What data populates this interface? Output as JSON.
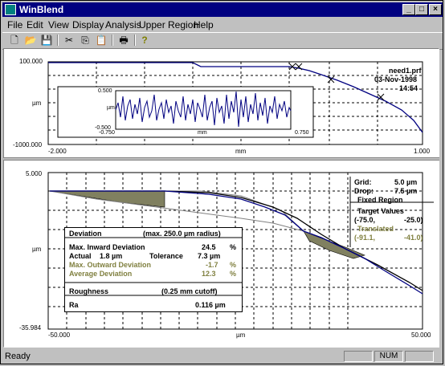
{
  "window": {
    "title": "WinBlend",
    "min": "_",
    "max": "□",
    "close": "×"
  },
  "menu": [
    "File",
    "Edit",
    "View",
    "Display",
    "Analysis",
    "Upper Region",
    "Help"
  ],
  "top_plot": {
    "file": "need1.prf",
    "date": "03-Nov-1998",
    "time": "14:54",
    "y_top": "100.000",
    "y_unit": "µm",
    "y_bottom": "-1000.000",
    "x_left": "-2.000",
    "x_unit": "mm",
    "x_right": "1.000",
    "inset": {
      "y_top": "0.500",
      "y_unit": "µm",
      "y_bottom": "-0.500",
      "x_left": "-0.750",
      "x_unit": "mm",
      "x_right": "0.750"
    }
  },
  "bottom_plot": {
    "y_top": "5.000",
    "y_unit": "µm",
    "y_bottom": "-35.984",
    "x_left": "-50.000",
    "x_unit": "µm",
    "x_right": "50.000"
  },
  "info": {
    "grid_label": "Grid:",
    "grid_value": "5.0  µm",
    "drop_label": "Drop:",
    "drop_value": "7.5  µm",
    "fixed": "Fixed Region",
    "target_label": "Target Values",
    "target_x": "(-75.0,",
    "target_y": "-25.0)",
    "translated_label": "Translated",
    "trans_x": "(-91.1,",
    "trans_y": "-41.0)"
  },
  "deviation": {
    "title": "Deviation",
    "radius": "(max. 250.0 µm radius)",
    "inward_label": "Max. Inward Deviation",
    "inward_value": "24.5",
    "inward_unit": "%",
    "actual_label": "Actual",
    "actual_value": "1.8  µm",
    "tol_label": "Tolerance",
    "tol_value": "7.3  µm",
    "outward_label": "Max. Outward Deviation",
    "outward_value": "-1.7",
    "outward_unit": "%",
    "avg_label": "Average Deviation",
    "avg_value": "12.3",
    "avg_unit": "%",
    "rough_label": "Roughness",
    "rough_cutoff": "(0.25 mm cutoff)",
    "ra_label": "Ra",
    "ra_value": "0.116 µm"
  },
  "status": {
    "text": "Ready",
    "num": "NUM"
  },
  "colors": {
    "titlebar": "#000080",
    "plot_line": "#000080",
    "fill": "#808060",
    "green_text": "#808040"
  }
}
